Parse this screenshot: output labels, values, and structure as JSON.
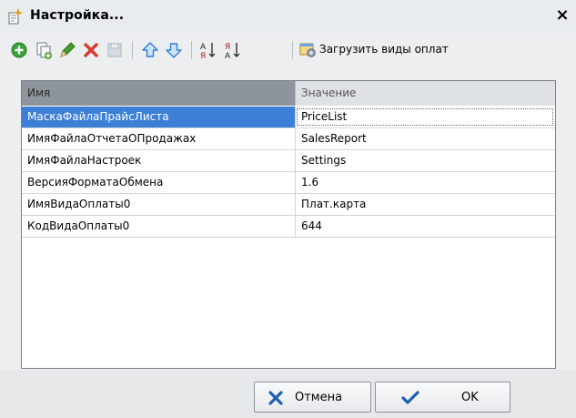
{
  "window": {
    "title": "Настройка...",
    "close_glyph": "×"
  },
  "toolbar": {
    "buttons": [
      {
        "name": "add-icon",
        "color": "#3aa33a"
      },
      {
        "name": "copy-icon",
        "color": "#5aa032"
      },
      {
        "name": "edit-icon",
        "color": "#4b9b2a"
      },
      {
        "name": "delete-icon",
        "color": "#d83a2f"
      },
      {
        "name": "end-edit-icon",
        "color": "#a7b3bf"
      },
      {
        "name": "move-up-icon",
        "color": "#2f7ed8"
      },
      {
        "name": "move-down-icon",
        "color": "#2f7ed8"
      },
      {
        "name": "sort-asc-icon",
        "color": "#a22"
      },
      {
        "name": "sort-desc-icon",
        "color": "#a22"
      }
    ],
    "load_payment_types_label": "Загрузить виды оплат"
  },
  "grid": {
    "columns": [
      "Имя",
      "Значение"
    ],
    "rows": [
      {
        "name": "МаскаФайлаПрайсЛиста",
        "value": "PriceList",
        "selected": true
      },
      {
        "name": "ИмяФайлаОтчетаОПродажах",
        "value": "SalesReport"
      },
      {
        "name": "ИмяФайлаНастроек",
        "value": "Settings"
      },
      {
        "name": "ВерсияФорматаОбмена",
        "value": "1.6"
      },
      {
        "name": "ИмяВидаОплаты0",
        "value": "Плат.карта"
      },
      {
        "name": "КодВидаОплаты0",
        "value": "644"
      }
    ]
  },
  "buttons": {
    "cancel_label": "Отмена",
    "ok_label": "OK"
  },
  "colors": {
    "selection": "#3c7fd6",
    "header_active": "#8d949c",
    "header_inactive": "#dfe2e5"
  }
}
